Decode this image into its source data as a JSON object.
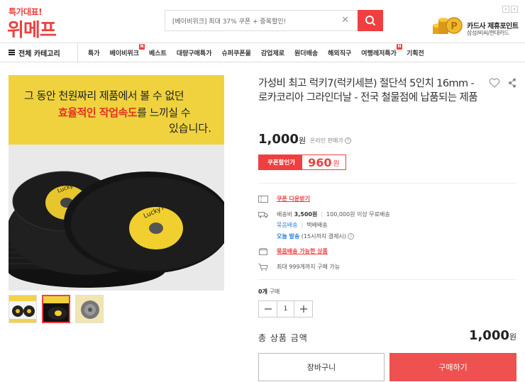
{
  "header": {
    "logo_small": "특가대표!",
    "logo_big": "위메프",
    "search": {
      "value": "[베이비위크] 최대 37% 쿠폰 + 중복할인!",
      "clear_icon": "close-icon",
      "button_icon": "search-icon"
    },
    "promo": {
      "title": "카드사 제휴포인트",
      "subtitle": "삼성/비씨/현대카드",
      "prev": "‹",
      "next": "›"
    }
  },
  "nav": {
    "all_categories": "전체 카테고리",
    "items": [
      {
        "label": "특가",
        "new": false
      },
      {
        "label": "베이비위크",
        "new": true
      },
      {
        "label": "베스트",
        "new": false
      },
      {
        "label": "대량구매특가",
        "new": false
      },
      {
        "label": "슈퍼쿠폰몰",
        "new": false
      },
      {
        "label": "감업제로",
        "new": false
      },
      {
        "label": "원더배송",
        "new": false
      },
      {
        "label": "해외직구",
        "new": false
      },
      {
        "label": "여행레저특가",
        "new": true
      },
      {
        "label": "기획전",
        "new": false
      }
    ],
    "new_badge": "N"
  },
  "image": {
    "line1": "그 동안 천원짜리 제품에서 볼 수 없던",
    "line2_highlight": "효율적인 작업속도",
    "line2_rest": "를 느끼실 수",
    "line3": "있습니다."
  },
  "product": {
    "title": "가성비 최고 럭키7(럭키세븐) 절단석 5인치 16mm - 로카코리아 그라인더날 - 전국 철물점에 납품되는 제품",
    "price": "1,000",
    "price_unit": "원",
    "price_note": "온라인 판매가",
    "coupon_label": "쿠폰할인가",
    "coupon_price": "960",
    "coupon_unit": "원",
    "coupon_download": "쿠폰 다운받기",
    "shipping_fee_label": "배송비",
    "shipping_fee": "3,500원",
    "free_shipping": "100,000원 이상 무료배송",
    "bundle": "묶음배송",
    "courier": "택배배송",
    "today_ship": "오늘 발송",
    "today_note": "(15시까지 결제시)",
    "bundle_available": "묶음배송 가능한 상품",
    "max_purchase": "최대 999개까지 구매 가능",
    "qty_prefix": "0개",
    "qty_suffix": "구매",
    "qty_value": "1",
    "total_label": "총 상품 금액",
    "total_price": "1,000",
    "total_unit": "원",
    "cart_label": "장바구니",
    "buy_label": "구매하기"
  },
  "colors": {
    "accent": "#ef3f3f",
    "link_blue": "#2a7de1",
    "image_yellow": "#efd23e"
  }
}
